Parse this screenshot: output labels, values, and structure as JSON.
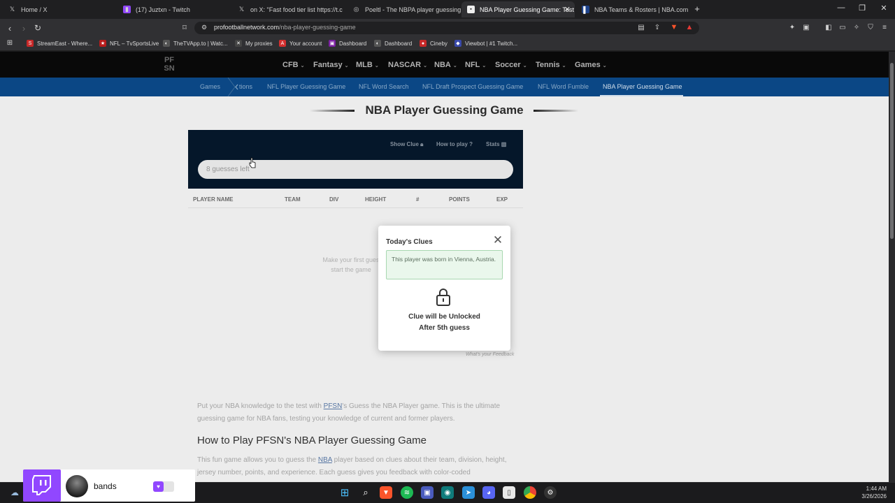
{
  "tabs": [
    {
      "title": "Home / X",
      "icon": "x-logo-icon"
    },
    {
      "title": "(17) Juztxn - Twitch",
      "icon": "twitch-icon"
    },
    {
      "title": "on X: \"Fast food tier list https://t.c",
      "icon": "x-logo-icon"
    },
    {
      "title": "Poeltl - The NBPA player guessing ga",
      "icon": "poeltl-icon"
    },
    {
      "title": "NBA Player Guessing Game: Test",
      "icon": "pfsn-icon",
      "active": true
    },
    {
      "title": "NBA Teams & Rosters | NBA.com",
      "icon": "nba-icon"
    }
  ],
  "address": {
    "domain": "profootballnetwork.com",
    "path": "/nba-player-guessing-game"
  },
  "bookmarks": [
    {
      "label": "StreamEast - Where...",
      "color": "#c62828",
      "glyph": "S"
    },
    {
      "label": "NFL – TvSportsLive",
      "color": "#b71c1c",
      "glyph": "★"
    },
    {
      "label": "TheTVApp.to | Watc...",
      "color": "#555555",
      "glyph": "◐"
    },
    {
      "label": "My proxies",
      "color": "#444444",
      "glyph": "✕"
    },
    {
      "label": "Your account",
      "color": "#d32f2f",
      "glyph": "A"
    },
    {
      "label": "Dashboard",
      "color": "#7b1fa2",
      "glyph": "▣"
    },
    {
      "label": "Dashboard",
      "color": "#555555",
      "glyph": "◐"
    },
    {
      "label": "Cineby",
      "color": "#c62828",
      "glyph": "●"
    },
    {
      "label": "Viewbot | #1 Twitch...",
      "color": "#3949ab",
      "glyph": "◆"
    }
  ],
  "site": {
    "logo": "PF SN",
    "nav": [
      "CFB",
      "Fantasy",
      "MLB",
      "NASCAR",
      "NBA",
      "NFL",
      "Soccer",
      "Tennis",
      "Games"
    ],
    "subnav": [
      "Games",
      "tions",
      "NFL Player Guessing Game",
      "NFL Word Search",
      "NFL Draft Prospect Guessing Game",
      "NFL Word Fumble",
      "NBA Player Guessing Game"
    ]
  },
  "game": {
    "title": "NBA Player Guessing Game",
    "links": {
      "show_clue": "Show Clue",
      "how_to_play": "How to play",
      "stats": "Stats"
    },
    "search_placeholder": "8 guesses left",
    "columns": [
      "PLAYER NAME",
      "TEAM",
      "DIV",
      "HEIGHT",
      "#",
      "POINTS",
      "EXP"
    ],
    "empty_line1": "Make your first gues",
    "empty_line2": "start the game",
    "feedback": "What's your Feedback"
  },
  "modal": {
    "title": "Today's Clues",
    "clue": "This player was born in Vienna, Austria.",
    "locked_line1": "Clue will be Unlocked",
    "locked_line2": "After 5th guess"
  },
  "article": {
    "p1_a": "Put your NBA knowledge to the test with ",
    "p1_link": "PFSN",
    "p1_b": "'s Guess the NBA Player game. This is the ultimate guessing game for NBA fans, testing your knowledge of current and former players.",
    "h2": "How to Play PFSN's NBA Player Guessing Game",
    "p2_a": "This fun game allows you to guess the ",
    "p2_link": "NBA",
    "p2_b": " player based on clues about their team, division, height, jersey number, points, and experience. Each guess gives you feedback with color-coded"
  },
  "twitch_widget": {
    "name": "bands"
  },
  "system": {
    "time": "1:44 AM",
    "date": "3/26/2026"
  },
  "colors": {
    "accent": "#0c4a8a",
    "game_bg": "#06182c",
    "twitch": "#9147ff"
  }
}
